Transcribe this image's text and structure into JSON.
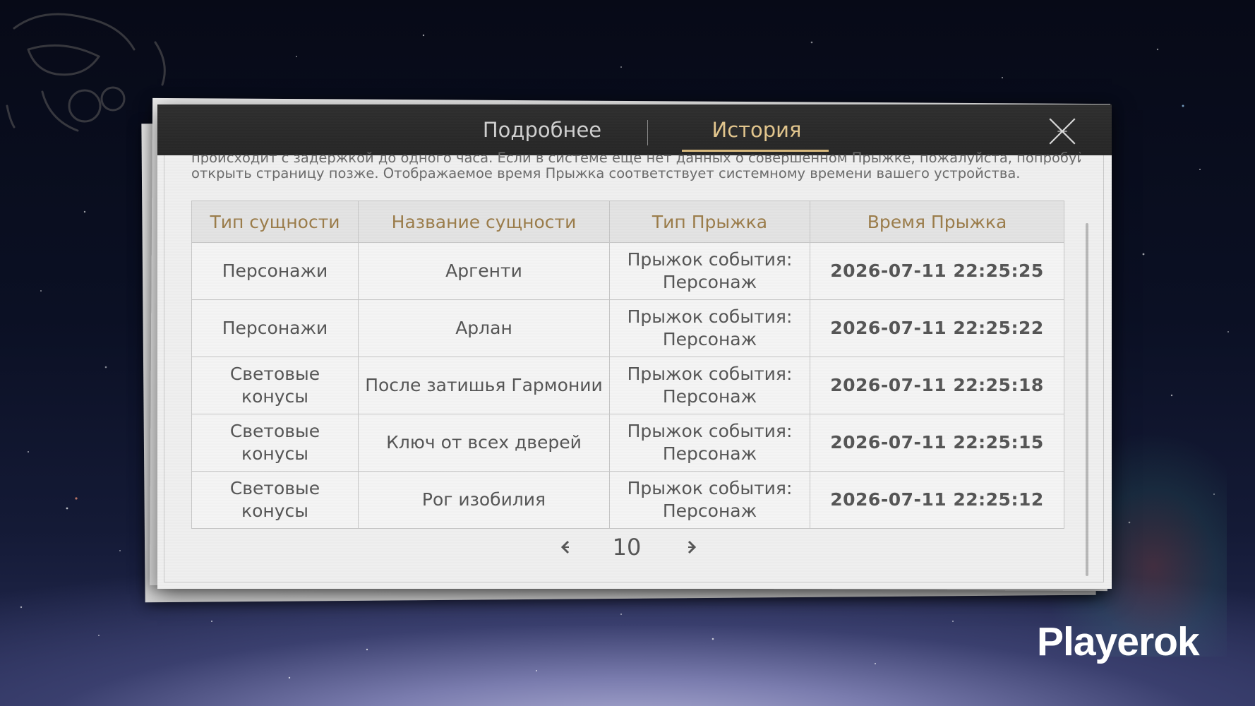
{
  "tabs": [
    {
      "label": "Подробнее",
      "active": false
    },
    {
      "label": "История",
      "active": true
    }
  ],
  "close_icon": "close-x-icon",
  "notice": {
    "line1": "происходит с задержкой до одного часа. Если в системе еще нет данных о совершенном Прыжке, пожалуйста, попробуйте",
    "line2": "открыть страницу позже. Отображаемое время Прыжка соответствует системному времени вашего устройства."
  },
  "table": {
    "headers": [
      "Тип сущности",
      "Название сущности",
      "Тип Прыжка",
      "Время Прыжка"
    ],
    "rows": [
      {
        "type": [
          "Персонажи"
        ],
        "name": "Аргенти",
        "name_color": "#c9a36a",
        "jump_type": [
          "Прыжок события:",
          "Персонаж"
        ],
        "time": "2026-07-11 22:25:25"
      },
      {
        "type": [
          "Персонажи"
        ],
        "name": "Арлан",
        "name_color": "#9a55d6",
        "jump_type": [
          "Прыжок события:",
          "Персонаж"
        ],
        "time": "2026-07-11 22:25:22"
      },
      {
        "type": [
          "Световые",
          "конусы"
        ],
        "name": "После затишья Гармонии",
        "name_color": "#9a55d6",
        "jump_type": [
          "Прыжок события:",
          "Персонаж"
        ],
        "time": "2026-07-11 22:25:18"
      },
      {
        "type": [
          "Световые",
          "конусы"
        ],
        "name": "Ключ от всех дверей",
        "name_color": "#555555",
        "jump_type": [
          "Прыжок события:",
          "Персонаж"
        ],
        "time": "2026-07-11 22:25:15"
      },
      {
        "type": [
          "Световые",
          "конусы"
        ],
        "name": "Рог изобилия",
        "name_color": "#555555",
        "jump_type": [
          "Прыжок события:",
          "Персонаж"
        ],
        "time": "2026-07-11 22:25:12"
      }
    ]
  },
  "pagination": {
    "page": "10",
    "prev_icon": "chevron-left-icon",
    "next_icon": "chevron-right-icon"
  },
  "colors": {
    "accent_gold": "#d9b97c",
    "header_text": "#9b7c4a",
    "rarity_5": "#c9a36a",
    "rarity_4": "#9a55d6"
  },
  "watermark": "Playerok"
}
